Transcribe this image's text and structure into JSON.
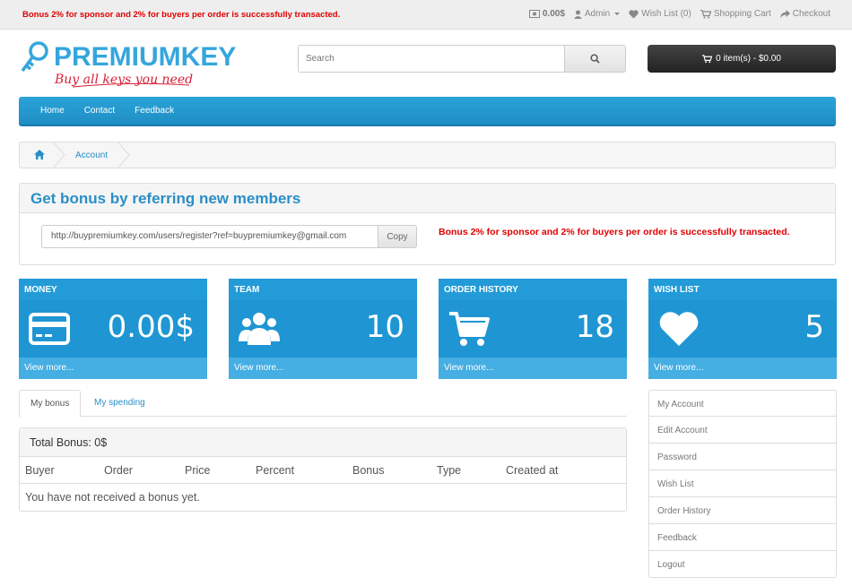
{
  "topbar": {
    "promo": "Bonus 2% for sponsor and 2% for buyers per order is successfully transacted.",
    "balance": "0.00$",
    "user": "Admin",
    "wishlist": "Wish List (0)",
    "cart": "Shopping Cart",
    "checkout": "Checkout"
  },
  "header": {
    "logo_text": "PREMIUMKEY",
    "logo_tagline": "Buy all keys you need",
    "search_placeholder": "Search",
    "cart_summary": "0 item(s) - $0.00"
  },
  "nav": {
    "items": [
      "Home",
      "Contact",
      "Feedback"
    ]
  },
  "breadcrumb": {
    "current": "Account"
  },
  "referral": {
    "title": "Get bonus by referring new members",
    "link": "http://buypremiumkey.com/users/register?ref=buypremiumkey@gmail.com",
    "copy_label": "Copy",
    "message": "Bonus 2% for sponsor and 2% for buyers per order is successfully transacted."
  },
  "tiles": [
    {
      "title": "MONEY",
      "value": "0.00$",
      "icon": "credit-card-icon",
      "more": "View more..."
    },
    {
      "title": "TEAM",
      "value": "10",
      "icon": "users-icon",
      "more": "View more..."
    },
    {
      "title": "ORDER HISTORY",
      "value": "18",
      "icon": "cart-icon",
      "more": "View more..."
    },
    {
      "title": "WISH LIST",
      "value": "5",
      "icon": "heart-icon",
      "more": "View more..."
    }
  ],
  "tabs": [
    "My bonus",
    "My spending"
  ],
  "bonus": {
    "total": "Total Bonus: 0$",
    "columns": [
      "Buyer",
      "Order",
      "Price",
      "Percent",
      "Bonus",
      "Type",
      "Created at"
    ],
    "empty": "You have not received a bonus yet."
  },
  "sidebar": {
    "items": [
      "My Account",
      "Edit Account",
      "Password",
      "Wish List",
      "Order History",
      "Feedback",
      "Logout"
    ]
  },
  "colors": {
    "accent": "#229bd8",
    "alert": "#e00000",
    "cart_button": "#2b2b2b"
  }
}
